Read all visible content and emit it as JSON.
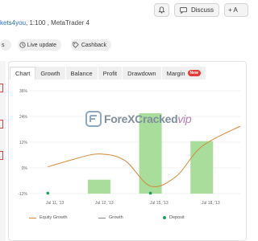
{
  "header": {
    "bell_icon": "bell-icon",
    "discuss_label": "Discuss",
    "third_label": "+ A"
  },
  "subtitle": {
    "account": "kets4you",
    "rest": ", 1:100 , MetaTrader 4"
  },
  "pills": [
    {
      "label": "s",
      "icon": ""
    },
    {
      "label": "Live update",
      "icon": "clock-icon"
    },
    {
      "label": "Cashback",
      "icon": "tag-icon"
    }
  ],
  "tabs": [
    {
      "label": "Chart",
      "active": true
    },
    {
      "label": "Growth",
      "active": false
    },
    {
      "label": "Balance",
      "active": false
    },
    {
      "label": "Profit",
      "active": false
    },
    {
      "label": "Drawdown",
      "active": false
    },
    {
      "label": "Margin",
      "active": false,
      "badge": "New"
    }
  ],
  "watermark": {
    "main": "ForeXCracked",
    "suffix": "vip"
  },
  "colors": {
    "growth_line": "#d48a3a",
    "growth_bars": "#a8dd9c",
    "deposit": "#19a05a",
    "badge": "#e53935"
  },
  "chart_data": {
    "type": "bar",
    "y_ticks": [
      "36%",
      "24%",
      "12%",
      "0%",
      "-12%"
    ],
    "ylim": [
      -12,
      36
    ],
    "x_ticks": [
      "Jul 11, '13",
      "Jul 12, '13",
      "Jul 15, '13",
      "Jul 18, '13"
    ],
    "x_tick_pos": [
      0,
      1,
      2,
      3
    ],
    "xlim": [
      -0.35,
      3.75
    ],
    "series": [
      {
        "name": "Equity Growth",
        "type": "line",
        "points": [
          [
            0,
            0.5
          ],
          [
            0.5,
            4
          ],
          [
            1,
            6.5
          ],
          [
            1.5,
            3.5
          ],
          [
            2,
            -8.5
          ],
          [
            2.5,
            -4
          ],
          [
            3,
            10
          ],
          [
            3.75,
            19.5
          ]
        ]
      },
      {
        "name": "Growth",
        "type": "bar",
        "bars": [
          [
            1,
            -5.5
          ],
          [
            2,
            25.5
          ],
          [
            3,
            12.5
          ]
        ]
      },
      {
        "name": "Deposit",
        "type": "scatter",
        "points": [
          [
            0,
            -11.8
          ],
          [
            2,
            -11.8
          ]
        ]
      }
    ],
    "legend": [
      "Equity Growth",
      "Growth",
      "Deposit"
    ],
    "legend_position": "bottom",
    "grid": true
  }
}
